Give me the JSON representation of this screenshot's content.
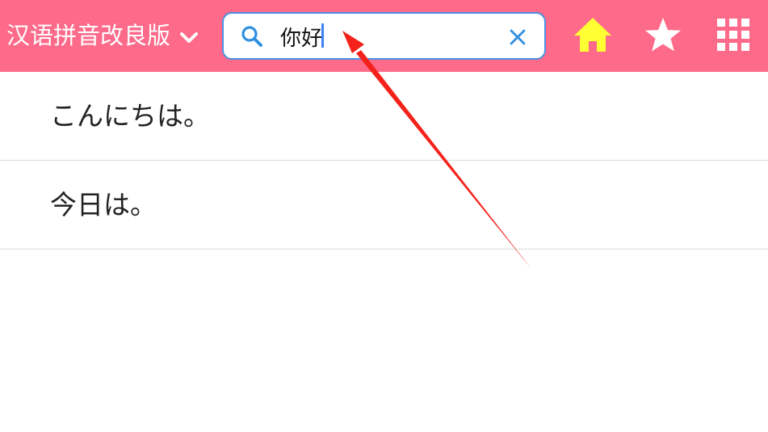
{
  "header": {
    "dictionary_selector": {
      "label": "汉语拼音改良版",
      "icon": "chevron-down-icon"
    },
    "search": {
      "value": "你好",
      "icon": "search-icon",
      "clear_icon": "close-icon"
    },
    "buttons": [
      {
        "name": "home",
        "icon": "home-icon"
      },
      {
        "name": "favorites",
        "icon": "star-icon"
      },
      {
        "name": "apps",
        "icon": "grid-icon"
      }
    ]
  },
  "results": [
    {
      "text": "こんにちは。"
    },
    {
      "text": "今日は。"
    }
  ],
  "colors": {
    "header_bg": "#fd6a8a",
    "search_border": "#4a90e2",
    "search_icon": "#2f8fe0",
    "home_icon": "#ffff33",
    "white_icon": "#ffffff",
    "divider": "#dcdcdc",
    "annotation_arrow": "#f5221b"
  }
}
